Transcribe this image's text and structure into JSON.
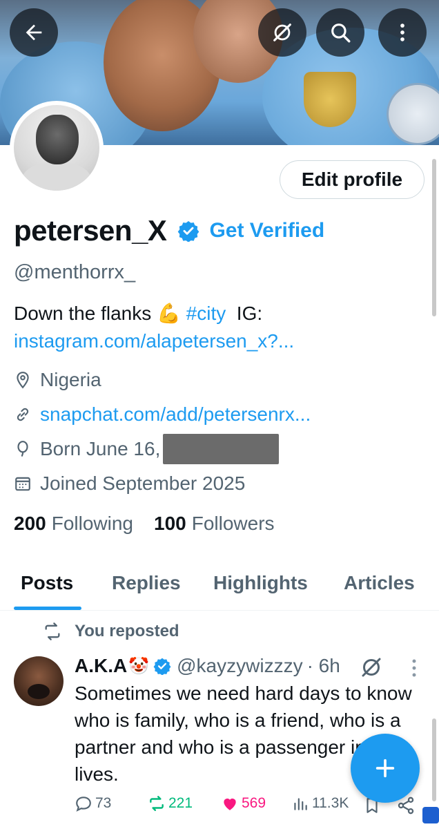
{
  "profile": {
    "display_name": "petersen_X",
    "get_verified": "Get Verified",
    "handle": "@menthorrx_",
    "edit_profile": "Edit profile",
    "bio_text": "Down the flanks",
    "bio_emoji": "💪",
    "bio_hashtag": "#city",
    "bio_ig_label": "IG:",
    "bio_link": "instagram.com/alapetersen_x?...",
    "location": "Nigeria",
    "website": "snapchat.com/add/petersenrx...",
    "birthday": "Born June 16,",
    "joined": "Joined September 2025",
    "following_count": "200",
    "following_label": "Following",
    "followers_count": "100",
    "followers_label": "Followers"
  },
  "tabs": [
    {
      "label": "Posts"
    },
    {
      "label": "Replies"
    },
    {
      "label": "Highlights"
    },
    {
      "label": "Articles"
    }
  ],
  "post": {
    "repost_label": "You reposted",
    "author_name": "A.K.A",
    "author_emoji": "🤡",
    "author_handle": "@kayzywizzzy",
    "time": "· 6h",
    "text": "Sometimes we need hard days to know who is family, who is a friend, who is a partner and who is a passenger in our lives.",
    "replies": "73",
    "reposts": "221",
    "likes": "569",
    "views": "11.3K"
  },
  "colors": {
    "accent": "#1d9bf0",
    "repost_green": "#00ba7c",
    "like_pink": "#f91880",
    "secondary_text": "#536471"
  }
}
